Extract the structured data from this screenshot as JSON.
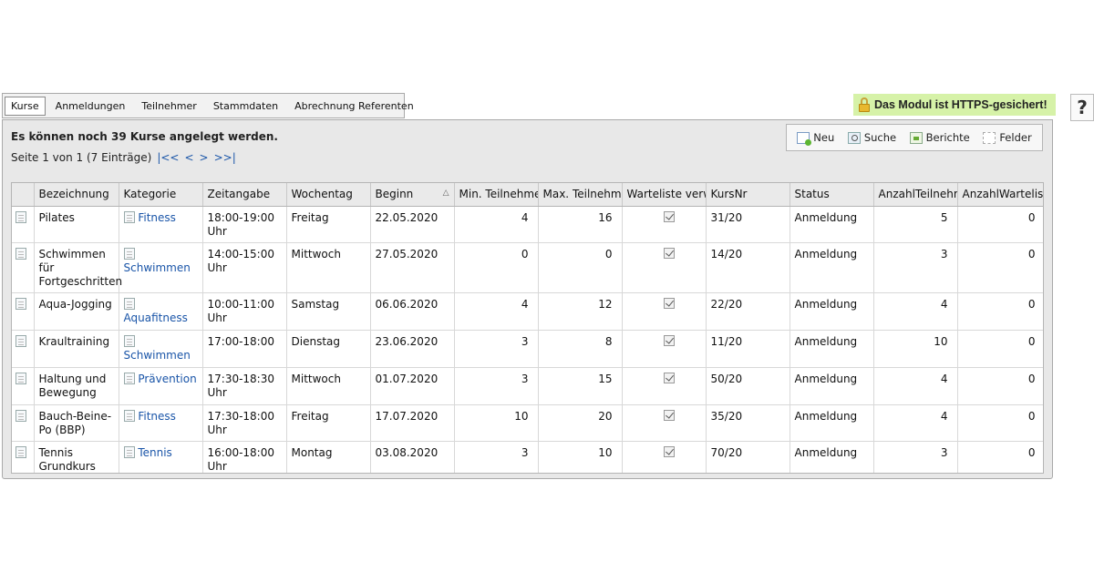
{
  "tabs": [
    {
      "label": "Kurse",
      "active": true
    },
    {
      "label": "Anmeldungen"
    },
    {
      "label": "Teilnehmer"
    },
    {
      "label": "Stammdaten"
    },
    {
      "label": "Abrechnung Referenten"
    }
  ],
  "https_badge": "Das Modul ist HTTPS-gesichert!",
  "help": "?",
  "panel": {
    "title": "Es können noch 39 Kurse angelegt werden.",
    "page_info": "Seite 1 von 1 (7 Einträge)",
    "nav_first": "|<<",
    "nav_prev": "<",
    "nav_next": ">",
    "nav_last": ">>|"
  },
  "toolbar": {
    "new_label": "Neu",
    "search_label": "Suche",
    "reports_label": "Berichte",
    "fields_label": "Felder"
  },
  "columns": [
    "Bezeichnung",
    "Kategorie",
    "Zeitangabe",
    "Wochentag",
    "Beginn",
    "Min. Teilnehmer",
    "Max. Teilnehmer",
    "Warteliste verwenden",
    "KursNr",
    "Status",
    "AnzahlTeilnehmer",
    "AnzahlWarteliste"
  ],
  "rows": [
    {
      "bezeichnung": "Pilates",
      "kategorie": "Fitness",
      "zeit": "18:00-19:00 Uhr",
      "wochentag": "Freitag",
      "beginn": "22.05.2020",
      "min": "4",
      "max": "16",
      "kursnr": "31/20",
      "status": "Anmeldung",
      "teilnehmer": "5",
      "warteliste": "0"
    },
    {
      "bezeichnung": "Schwimmen für Fortgeschritten",
      "kategorie": "Schwimmen",
      "zeit": "14:00-15:00 Uhr",
      "wochentag": "Mittwoch",
      "beginn": "27.05.2020",
      "min": "0",
      "max": "0",
      "kursnr": "14/20",
      "status": "Anmeldung",
      "teilnehmer": "3",
      "warteliste": "0"
    },
    {
      "bezeichnung": "Aqua-Jogging",
      "kategorie": "Aquafitness",
      "zeit": "10:00-11:00 Uhr",
      "wochentag": "Samstag",
      "beginn": "06.06.2020",
      "min": "4",
      "max": "12",
      "kursnr": "22/20",
      "status": "Anmeldung",
      "teilnehmer": "4",
      "warteliste": "0"
    },
    {
      "bezeichnung": "Kraultraining",
      "kategorie": "Schwimmen",
      "zeit": "17:00-18:00",
      "wochentag": "Dienstag",
      "beginn": "23.06.2020",
      "min": "3",
      "max": "8",
      "kursnr": "11/20",
      "status": "Anmeldung",
      "teilnehmer": "10",
      "warteliste": "0"
    },
    {
      "bezeichnung": "Haltung und Bewegung",
      "kategorie": "Prävention",
      "zeit": "17:30-18:30 Uhr",
      "wochentag": "Mittwoch",
      "beginn": "01.07.2020",
      "min": "3",
      "max": "15",
      "kursnr": "50/20",
      "status": "Anmeldung",
      "teilnehmer": "4",
      "warteliste": "0"
    },
    {
      "bezeichnung": "Bauch-Beine-Po (BBP)",
      "kategorie": "Fitness",
      "zeit": "17:30-18:00 Uhr",
      "wochentag": "Freitag",
      "beginn": "17.07.2020",
      "min": "10",
      "max": "20",
      "kursnr": "35/20",
      "status": "Anmeldung",
      "teilnehmer": "4",
      "warteliste": "0"
    },
    {
      "bezeichnung": "Tennis Grundkurs",
      "kategorie": "Tennis",
      "zeit": "16:00-18:00 Uhr",
      "wochentag": "Montag",
      "beginn": "03.08.2020",
      "min": "3",
      "max": "10",
      "kursnr": "70/20",
      "status": "Anmeldung",
      "teilnehmer": "3",
      "warteliste": "0"
    }
  ]
}
